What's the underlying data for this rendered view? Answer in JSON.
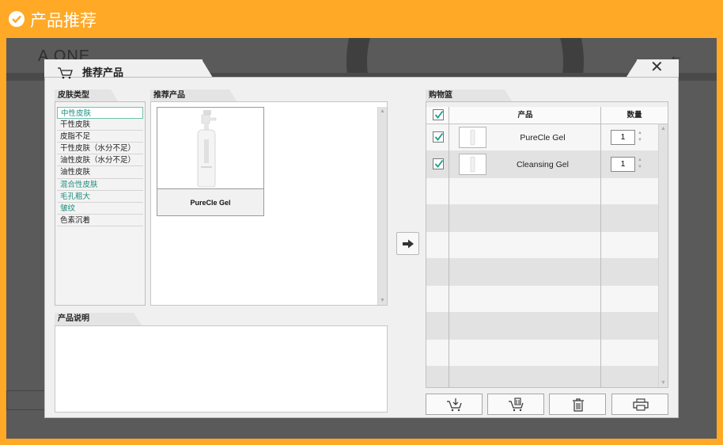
{
  "header": {
    "title": "产品推荐",
    "icon": "check-circle-icon"
  },
  "background_app": {
    "title": "A ONE",
    "arrow": "←"
  },
  "dialog": {
    "title": "推荐产品",
    "icon": "cart-icon",
    "close_label": "✕"
  },
  "skin_panel": {
    "label": "皮肤类型",
    "items": [
      {
        "label": "中性皮肤",
        "style": "selected"
      },
      {
        "label": "干性皮肤",
        "style": "normal"
      },
      {
        "label": "皮脂不足",
        "style": "normal"
      },
      {
        "label": "干性皮肤（水分不足）",
        "style": "normal"
      },
      {
        "label": "油性皮肤（水分不足）",
        "style": "normal"
      },
      {
        "label": "油性皮肤",
        "style": "normal"
      },
      {
        "label": "混合性皮肤",
        "style": "green"
      },
      {
        "label": "毛孔粗大",
        "style": "green"
      },
      {
        "label": "皱纹",
        "style": "green"
      },
      {
        "label": "色素沉着",
        "style": "normal"
      }
    ]
  },
  "products_panel": {
    "label": "推荐产品",
    "products": [
      {
        "name": "PureCle Gel"
      }
    ]
  },
  "description_panel": {
    "label": "产品说明",
    "text": ""
  },
  "cart_panel": {
    "label": "购物篮",
    "columns": {
      "product": "产品",
      "quantity": "数量"
    },
    "rows": [
      {
        "name": "PureCle Gel",
        "qty": "1",
        "checked": true
      },
      {
        "name": "Cleansing Gel",
        "qty": "1",
        "checked": true
      }
    ],
    "header_checked": true
  },
  "toolbar": {
    "buttons": [
      {
        "icon": "cart-add-icon"
      },
      {
        "icon": "cart-remove-icon"
      },
      {
        "icon": "trash-icon"
      },
      {
        "icon": "print-icon"
      }
    ]
  },
  "colors": {
    "accent": "#ffa926",
    "green_text": "#1e8f80"
  }
}
